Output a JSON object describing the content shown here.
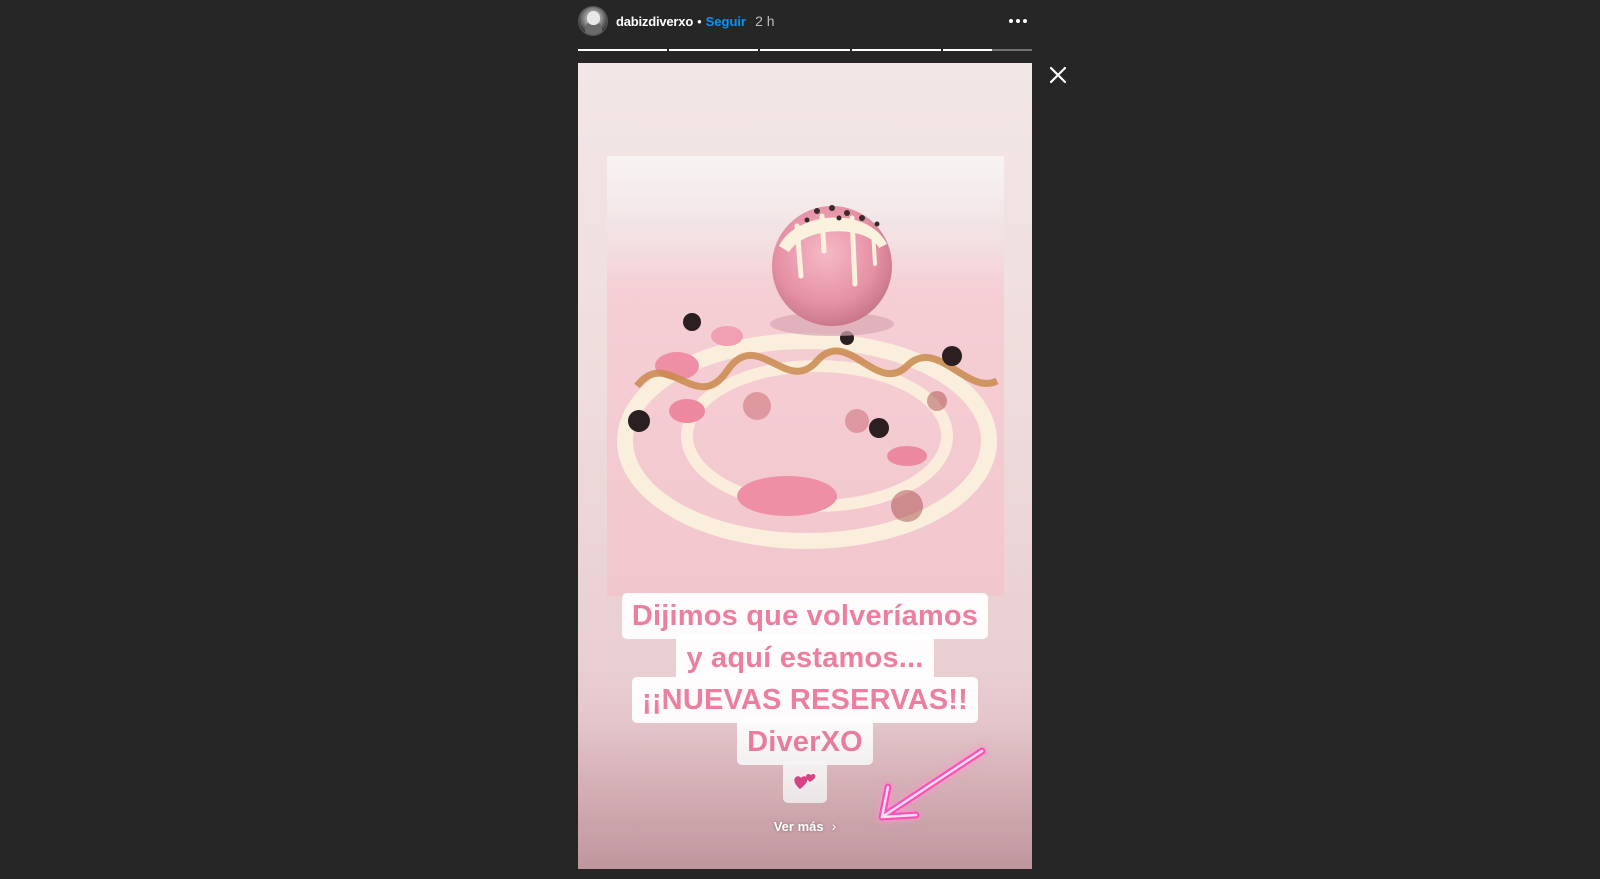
{
  "header": {
    "username": "dabizdiverxo",
    "separator": "•",
    "follow_label": "Seguir",
    "time_ago": "2 h",
    "more_icon": "more-horizontal-icon"
  },
  "progress": {
    "segments": [
      1,
      1,
      1,
      1,
      0.55
    ]
  },
  "close_icon": "close-icon",
  "story": {
    "caption_lines": [
      "Dijimos que volveríamos",
      "y aquí estamos...",
      "¡¡NUEVAS RESERVAS!!",
      "DiverXO"
    ],
    "caption_emoji": "💕",
    "see_more_label": "Ver más",
    "see_more_chevron": "›",
    "colors": {
      "caption_text": "#ec7f9e",
      "caption_bg": "#ffffff",
      "follow": "#0095f6",
      "neon_arrow": "#ff4fb8"
    }
  }
}
